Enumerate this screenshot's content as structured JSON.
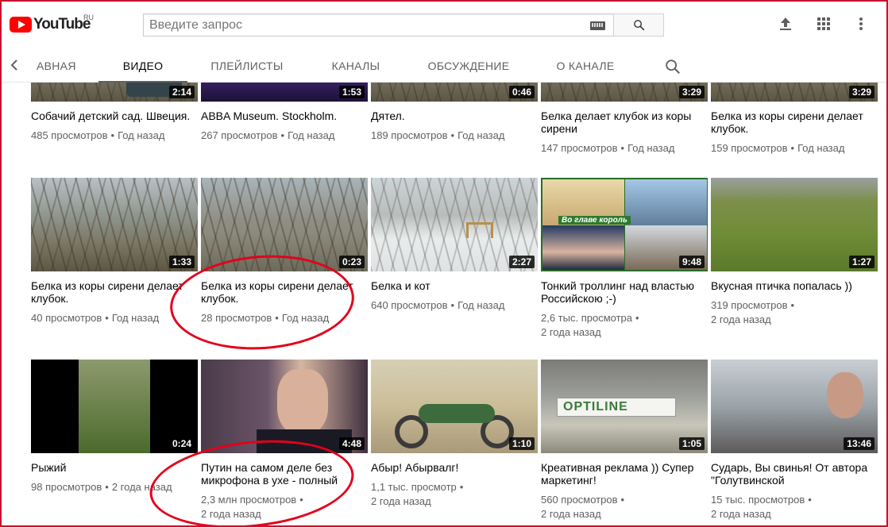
{
  "header": {
    "logo_text": "YouTube",
    "logo_country": "RU",
    "search_placeholder": "Введите запрос",
    "icons": [
      "keyboard-icon",
      "search-icon",
      "upload-icon",
      "apps-icon",
      "more-vert-icon"
    ]
  },
  "tabs": {
    "items": [
      {
        "label": "АВНАЯ",
        "active": false
      },
      {
        "label": "ВИДЕО",
        "active": true
      },
      {
        "label": "ПЛЕЙЛИСТЫ",
        "active": false
      },
      {
        "label": "КАНАЛЫ",
        "active": false
      },
      {
        "label": "ОБСУЖДЕНИЕ",
        "active": false
      },
      {
        "label": "О КАНАЛЕ",
        "active": false
      }
    ]
  },
  "videos": [
    {
      "title": "Собачий детский сад. Швеция.",
      "duration": "2:14",
      "views": "485 просмотров",
      "age": "Год назад"
    },
    {
      "title": "ABBA Museum. Stockholm.",
      "duration": "1:53",
      "views": "267 просмотров",
      "age": "Год назад"
    },
    {
      "title": "Дятел.",
      "duration": "0:46",
      "views": "189 просмотров",
      "age": "Год назад"
    },
    {
      "title": "Белка делает клубок из коры сирени",
      "duration": "3:29",
      "views": "147 просмотров",
      "age": "Год назад"
    },
    {
      "title": "Белка из коры сирени делает клубок.",
      "duration": "3:29",
      "views": "159 просмотров",
      "age": "Год назад"
    },
    {
      "title": "Белка из коры сирени делает клубок.",
      "duration": "1:33",
      "views": "40 просмотров",
      "age": "Год назад"
    },
    {
      "title": "Белка из коры сирени делает клубок.",
      "duration": "0:23",
      "views": "28 просмотров",
      "age": "Год назад"
    },
    {
      "title": "Белка и кот",
      "duration": "2:27",
      "views": "640 просмотров",
      "age": "Год назад"
    },
    {
      "title": "Тонкий троллинг над властью Российскою ;-)",
      "duration": "9:48",
      "views": "2,6 тыс. просмотра",
      "age": "2 года назад",
      "thumb_caption": "Во главе король"
    },
    {
      "title": "Вкусная птичка попалась ))",
      "duration": "1:27",
      "views": "319 просмотров",
      "age": "2 года назад"
    },
    {
      "title": "Рыжий",
      "duration": "0:24",
      "views": "98 просмотров",
      "age": "2 года назад"
    },
    {
      "title": "Путин на самом деле без микрофона в ухе - полный",
      "duration": "4:48",
      "views": "2,3 млн просмотров",
      "age": "2 года назад"
    },
    {
      "title": "Абыр! Абырвалг!",
      "duration": "1:10",
      "views": "1,1 тыс. просмотр",
      "age": "2 года назад"
    },
    {
      "title": "Креативная реклама )) Супер маркетинг!",
      "duration": "1:05",
      "views": "560 просмотров",
      "age": "2 года назад",
      "thumb_caption": "OPTILINE"
    },
    {
      "title": "Сударь, Вы свинья! От автора \"Голутвинской",
      "duration": "13:46",
      "views": "15 тыс. просмотров",
      "age": "2 года назад"
    }
  ],
  "colors": {
    "accent": "#ff0000",
    "annotation": "#e3001b",
    "text_secondary": "#606060"
  }
}
